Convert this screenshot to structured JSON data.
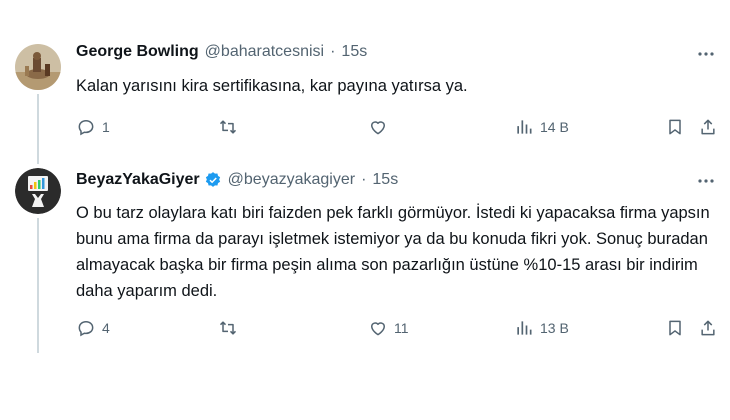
{
  "tweets": [
    {
      "author_name": "George Bowling",
      "handle": "@baharatcesnisi",
      "separator": "·",
      "time": "15s",
      "text": "Kalan yarısını kira sertifikasına, kar payına yatırsa ya.",
      "replies": "1",
      "retweets": "",
      "likes": "",
      "views": "14 B"
    },
    {
      "author_name": "BeyazYakaGiyer",
      "handle": "@beyazyakagiyer",
      "separator": "·",
      "time": "15s",
      "text": "O bu tarz olaylara katı biri faizden pek farklı görmüyor. İstedi ki yapacaksa firma yapsın bunu ama firma da parayı işletmek istemiyor ya da bu konuda fikri yok. Sonuç buradan almayacak başka bir firma peşin alıma son pazarlığın üstüne %10-15 arası bir indirim daha yaparım dedi.",
      "replies": "4",
      "retweets": "",
      "likes": "11",
      "views": "13 B"
    }
  ],
  "colors": {
    "text": "#0f1419",
    "secondary": "#536471",
    "verified": "#1d9bf0",
    "thread_line": "#cfd9de"
  },
  "icons": [
    "reply-icon",
    "retweet-icon",
    "like-icon",
    "views-icon",
    "bookmark-icon",
    "share-icon",
    "more-icon",
    "verified-badge-icon"
  ]
}
